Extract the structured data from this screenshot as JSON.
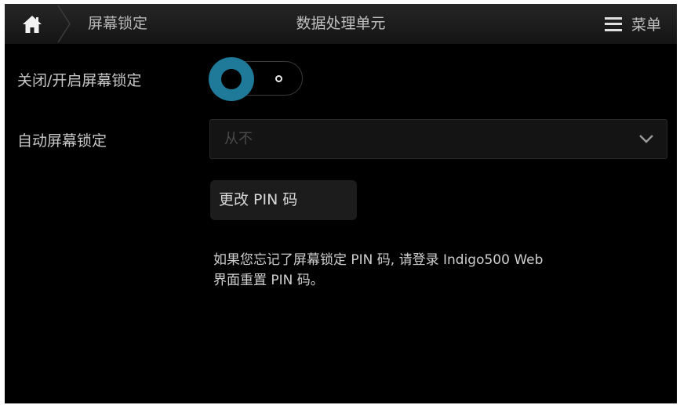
{
  "header": {
    "home_icon": "home-icon",
    "breadcrumb": "屏幕锁定",
    "title": "数据处理单元",
    "menu_icon": "hamburger-menu-icon",
    "menu_label": "菜单"
  },
  "settings": {
    "lock_toggle": {
      "label": "关闭/开启屏幕锁定",
      "state": "off"
    },
    "auto_lock": {
      "label": "自动屏幕锁定",
      "selected": "从不",
      "chevron_icon": "chevron-down-icon"
    },
    "change_pin_label": "更改 PIN 码",
    "note_line1": "如果您忘记了屏幕锁定 PIN 码, 请登录 Indigo500 Web",
    "note_line2": "界面重置 PIN 码。"
  },
  "colors": {
    "accent": "#1f7a99",
    "background": "#000000",
    "topbar": "#1c1c1c"
  }
}
